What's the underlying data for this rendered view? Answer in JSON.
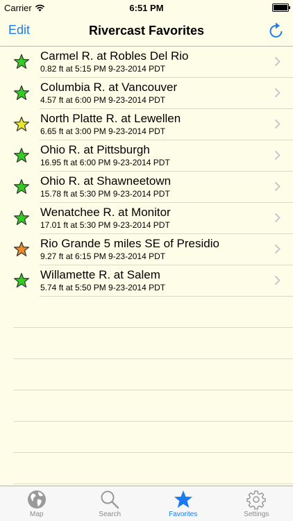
{
  "status_bar": {
    "carrier": "Carrier",
    "time": "6:51 PM"
  },
  "nav": {
    "edit_label": "Edit",
    "title": "Rivercast Favorites",
    "refresh_icon": "refresh-icon"
  },
  "favorites": [
    {
      "name": "Carmel R. at Robles Del Rio",
      "detail": "0.82 ft at 5:15 PM 9-23-2014 PDT",
      "star_color": "#33cc22"
    },
    {
      "name": "Columbia R. at Vancouver",
      "detail": "4.57 ft at 6:00 PM 9-23-2014 PDT",
      "star_color": "#33cc22"
    },
    {
      "name": "North Platte R. at Lewellen",
      "detail": "6.65 ft at 3:00 PM 9-23-2014 PDT",
      "star_color": "#e6e62a"
    },
    {
      "name": "Ohio R. at Pittsburgh",
      "detail": "16.95 ft at 6:00 PM 9-23-2014 PDT",
      "star_color": "#33cc22"
    },
    {
      "name": "Ohio R. at Shawneetown",
      "detail": "15.78 ft at 5:30 PM 9-23-2014 PDT",
      "star_color": "#33cc22"
    },
    {
      "name": "Wenatchee R. at Monitor",
      "detail": "17.01 ft at 5:30 PM 9-23-2014 PDT",
      "star_color": "#33cc22"
    },
    {
      "name": "Rio Grande 5 miles SE of Presidio",
      "detail": "9.27 ft at 6:15 PM 9-23-2014 PDT",
      "star_color": "#e8892a"
    },
    {
      "name": "Willamette R. at Salem",
      "detail": "5.74 ft at 5:50 PM 9-23-2014 PDT",
      "star_color": "#33cc22"
    }
  ],
  "tabs": [
    {
      "label": "Map",
      "icon": "globe-icon",
      "active": false
    },
    {
      "label": "Search",
      "icon": "magnifier-icon",
      "active": false
    },
    {
      "label": "Favorites",
      "icon": "star-icon",
      "active": true
    },
    {
      "label": "Settings",
      "icon": "gear-icon",
      "active": false
    }
  ],
  "colors": {
    "accent": "#1a7cf0",
    "background": "#fefee8"
  }
}
